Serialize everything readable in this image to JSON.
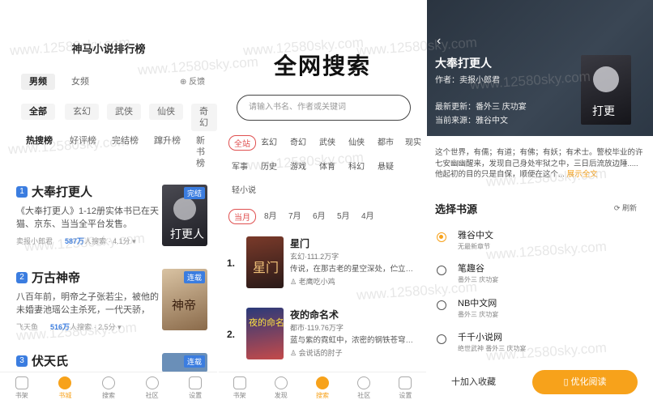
{
  "watermark": "www.12580sky.com",
  "ranking": {
    "title": "神马小说排行榜",
    "gender_tabs": [
      "男频",
      "女频"
    ],
    "feedback": "⊕ 反馈",
    "genres": [
      "全部",
      "玄幻",
      "武侠",
      "仙侠",
      "奇幻"
    ],
    "lists": [
      "热搜榜",
      "好评榜",
      "完结榜",
      "蹿升榜",
      "新书榜"
    ],
    "books": [
      {
        "num": "1",
        "title": "大奉打更人",
        "desc": "《大奉打更人》1-12册实体书已在天猫、京东、当当全平台发售。",
        "author": "卖报小郎君",
        "hot": "587万",
        "hot_label": "人搜索",
        "rating": "4.1分",
        "tag": "完结"
      },
      {
        "num": "2",
        "title": "万古神帝",
        "desc": "八百年前，明帝之子张若尘，被他的未婚妻池瑶公主杀死，一代天骄，",
        "author": "飞天鱼",
        "hot": "516万",
        "hot_label": "人搜索",
        "rating": "2.5分",
        "tag": "连载"
      },
      {
        "num": "3",
        "title": "伏天氏",
        "tag": "连载"
      }
    ]
  },
  "tabbar_left": [
    "书架",
    "书城",
    "搜索",
    "社区",
    "设置"
  ],
  "search": {
    "title": "全网搜索",
    "placeholder": "请输入书名、作者或关键词",
    "cat_row1": [
      "全站",
      "玄幻",
      "奇幻",
      "武侠",
      "仙侠",
      "都市",
      "现实"
    ],
    "cat_row2": [
      "军事",
      "历史",
      "游戏",
      "体育",
      "科幻",
      "悬疑"
    ],
    "cat_row3": [
      "轻小说"
    ],
    "time_row": [
      "当月",
      "8月",
      "7月",
      "6月",
      "5月",
      "4月"
    ],
    "results": [
      {
        "num": "1.",
        "title": "星门",
        "sub": "玄幻·111.2万字",
        "desc": "传说，在那古老的星空深处，伫立…",
        "author": "老鹰吃小鸡"
      },
      {
        "num": "2.",
        "title": "夜的命名术",
        "sub": "都市·119.76万字",
        "desc": "蓝与紫的霓虹中，浓密的钢铁苍穹…",
        "author": "会说话的肘子"
      }
    ]
  },
  "tabbar_mid": [
    "书架",
    "发现",
    "搜索",
    "社区",
    "设置"
  ],
  "detail": {
    "back": "‹",
    "title": "大奉打更人",
    "author": "作者：卖报小郎君",
    "latest": "最新更新：番外三 庆功宴",
    "source": "当前来源：雅谷中文",
    "intro": "这个世界，有儒；有道；有佛；有妖；有术士。警校毕业的许七安幽幽醒来，发现自己身处牢狱之中，三日后流放边陲.....他起初的目的只是自保，顺便在这个...",
    "more": "展示全文",
    "source_heading": "选择书源",
    "refresh": "刷新",
    "sources": [
      {
        "name": "雅谷中文",
        "sub": "无最新章节",
        "selected": true
      },
      {
        "name": "笔趣谷",
        "sub": "番外三 庆功宴"
      },
      {
        "name": "NB中文网",
        "sub": "番外三 庆功宴"
      },
      {
        "name": "千千小说网",
        "sub": "绝世武神 番外三 庆功宴"
      }
    ],
    "add_shelf": "十加入收藏",
    "read": "优化阅读"
  },
  "colors": {
    "accent": "#f7a21b",
    "blue": "#3b7de0",
    "red": "#e05050"
  }
}
